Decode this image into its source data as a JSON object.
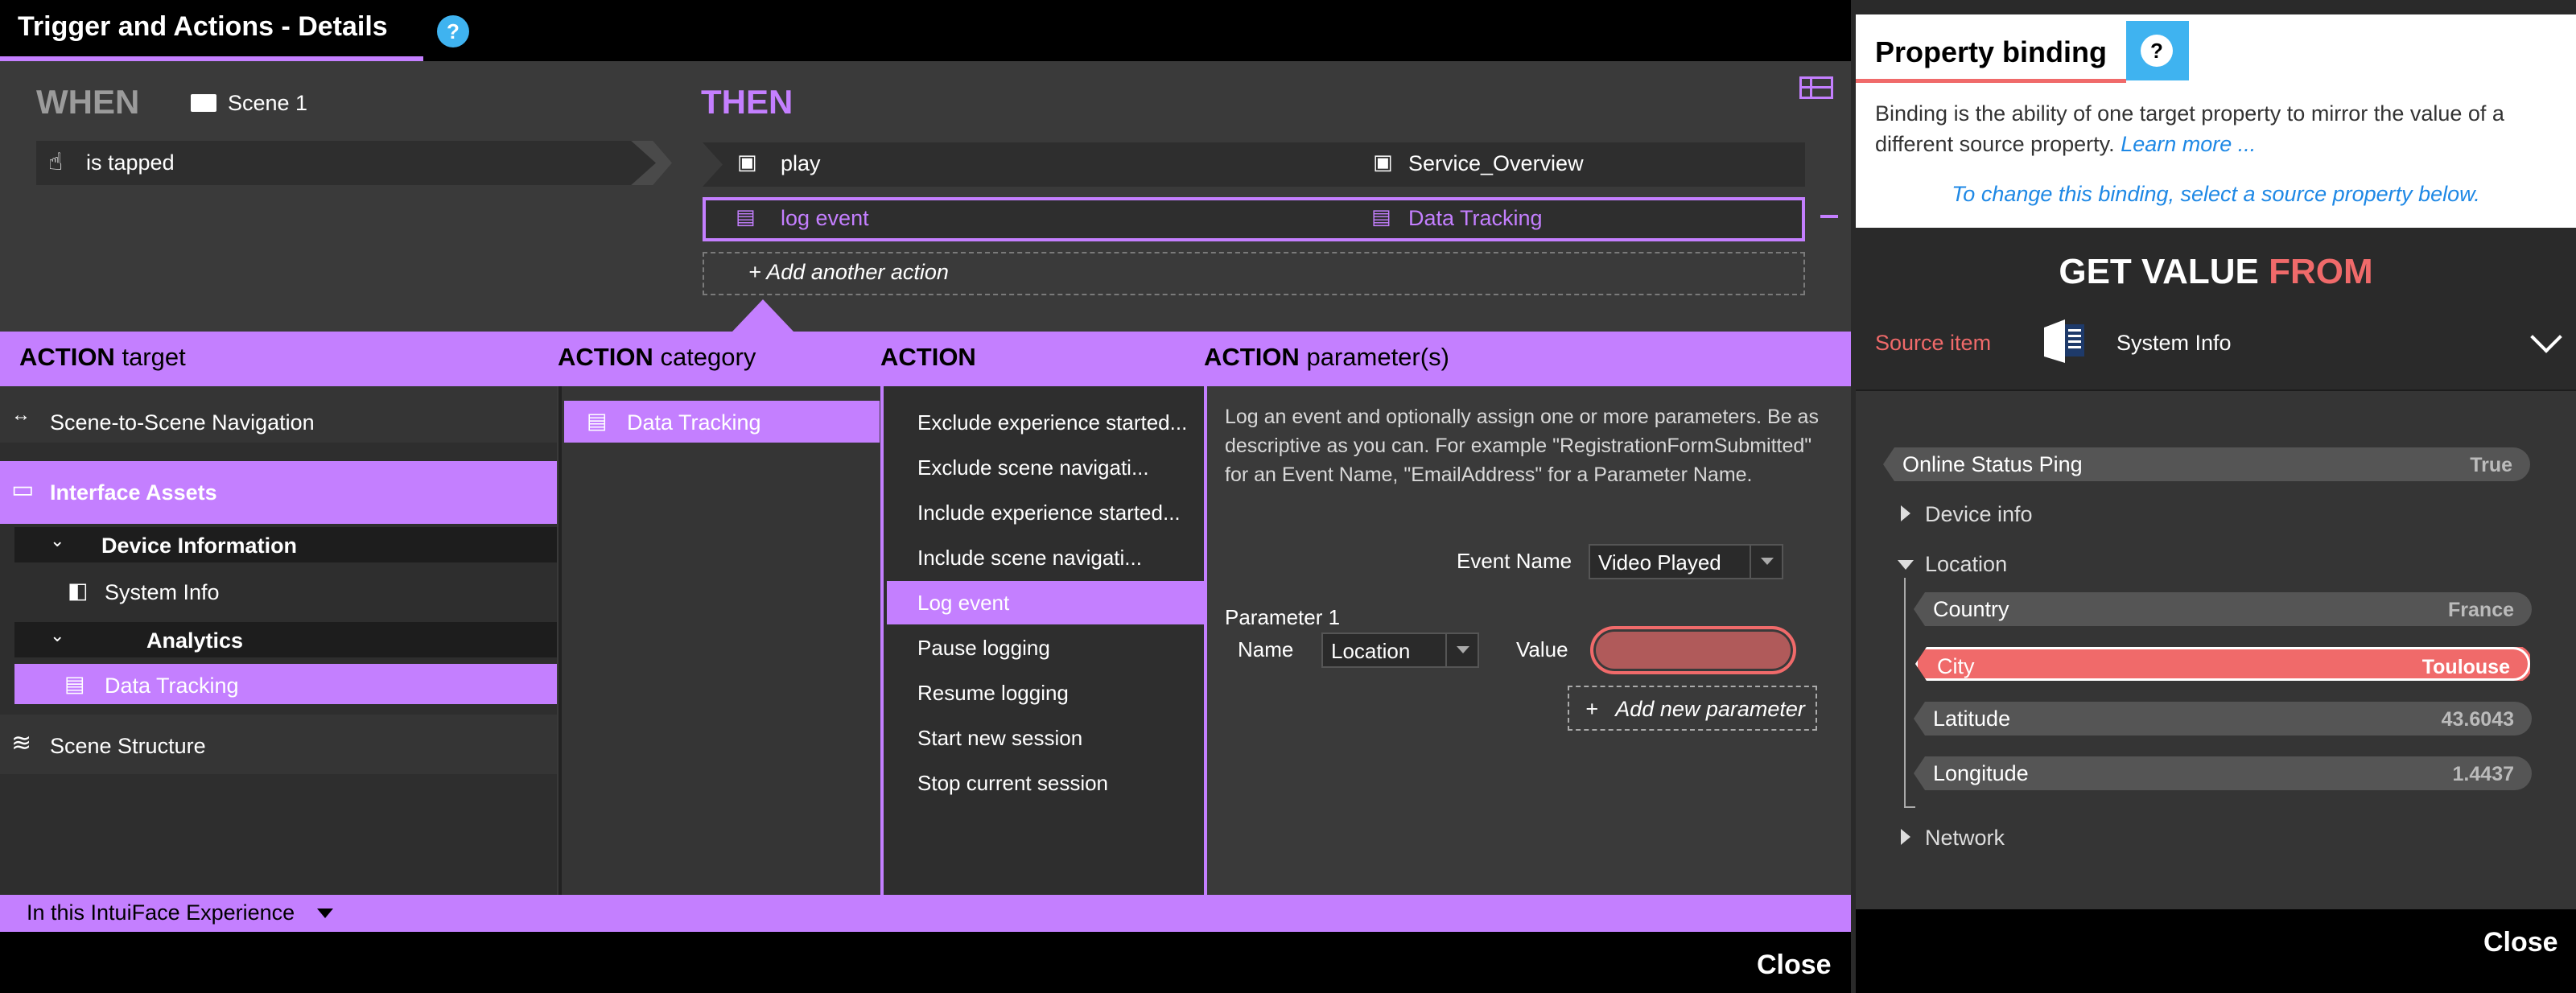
{
  "left_window": {
    "title": "Trigger and Actions - Details",
    "help": "?",
    "when": {
      "label": "WHEN",
      "scene": "Scene 1",
      "trigger": "is tapped"
    },
    "then": {
      "label": "THEN",
      "actions": [
        {
          "verb": "play",
          "target": "Service_Overview"
        },
        {
          "verb": "log event",
          "target": "Data Tracking"
        }
      ],
      "add_action": "Add another action"
    },
    "columns": {
      "target_header": {
        "bold": "ACTION",
        "rest": "target"
      },
      "category_header": {
        "bold": "ACTION",
        "rest": "category"
      },
      "action_header": {
        "bold": "ACTION",
        "rest": ""
      },
      "params_header": {
        "bold": "ACTION",
        "rest": "parameter(s)"
      }
    },
    "targets": {
      "nav": "Scene-to-Scene Navigation",
      "interface_assets": "Interface Assets",
      "device_information": "Device Information",
      "system_info": "System Info",
      "analytics": "Analytics",
      "data_tracking": "Data Tracking",
      "scene_structure": "Scene Structure"
    },
    "category": "Data Tracking",
    "actions_list": [
      "Exclude experience started...",
      "Exclude scene navigati...",
      "Include experience started...",
      "Include scene navigati...",
      "Log event",
      "Pause logging",
      "Resume logging",
      "Start new session",
      "Stop current session"
    ],
    "params": {
      "description": "Log an event and optionally assign one or more parameters. Be as descriptive as you can. For example \"RegistrationFormSubmitted\" for an Event Name, \"EmailAddress\" for a Parameter Name.",
      "event_name_label": "Event Name",
      "event_name_value": "Video Played",
      "parameter_label": "Parameter 1",
      "name_label": "Name",
      "name_value": "Location",
      "value_label": "Value",
      "add_param": "Add new parameter"
    },
    "footer": "In this IntuiFace Experience",
    "close": "Close"
  },
  "right_panel": {
    "title": "Property binding",
    "help": "?",
    "description": "Binding is the ability of one target property to mirror the value of a different source property.",
    "learn_more": "Learn more ...",
    "hint": "To change this binding, select a source property below.",
    "get_value": "GET VALUE",
    "from": "FROM",
    "source_label": "Source item",
    "source_name": "System Info",
    "tree": {
      "online_status": {
        "label": "Online Status Ping",
        "value": "True"
      },
      "device_info": "Device info",
      "location": "Location",
      "country": {
        "label": "Country",
        "value": "France"
      },
      "city": {
        "label": "City",
        "value": "Toulouse"
      },
      "latitude": {
        "label": "Latitude",
        "value": "43.6043"
      },
      "longitude": {
        "label": "Longitude",
        "value": "1.4437"
      },
      "network": "Network"
    },
    "close": "Close"
  },
  "colors": {
    "accent": "#c47fff",
    "binding": "#f06a6a",
    "help": "#3fb3f0"
  }
}
